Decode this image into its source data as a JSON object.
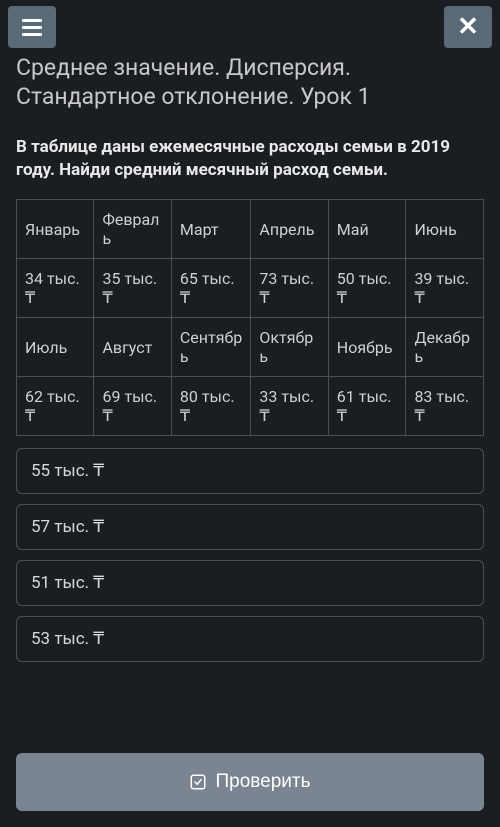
{
  "title": "Среднее значение. Дисперсия. Стандартное отклонение. Урок 1",
  "question": "В таблице даны ежемесячные расходы семьи в 2019 году. Найди средний месячный расход семьи.",
  "table": {
    "row0": [
      "Январь",
      "Февраль",
      "Март",
      "Апрель",
      "Май",
      "Июнь"
    ],
    "row1": [
      "34 тыс. ₸",
      "35 тыс. ₸",
      "65 тыс. ₸",
      "73 тыс. ₸",
      "50 тыс. ₸",
      "39 тыс. ₸"
    ],
    "row2": [
      "Июль",
      "Август",
      "Сентябрь",
      "Октябрь",
      "Ноябрь",
      "Декабрь"
    ],
    "row3": [
      "62 тыс. ₸",
      "69 тыс. ₸",
      "80 тыс. ₸",
      "33 тыс. ₸",
      "61 тыс. ₸",
      "83 тыс. ₸"
    ]
  },
  "options": [
    "55 тыс. ₸",
    "57 тыс. ₸",
    "51 тыс. ₸",
    "53 тыс. ₸"
  ],
  "check_label": "Проверить"
}
